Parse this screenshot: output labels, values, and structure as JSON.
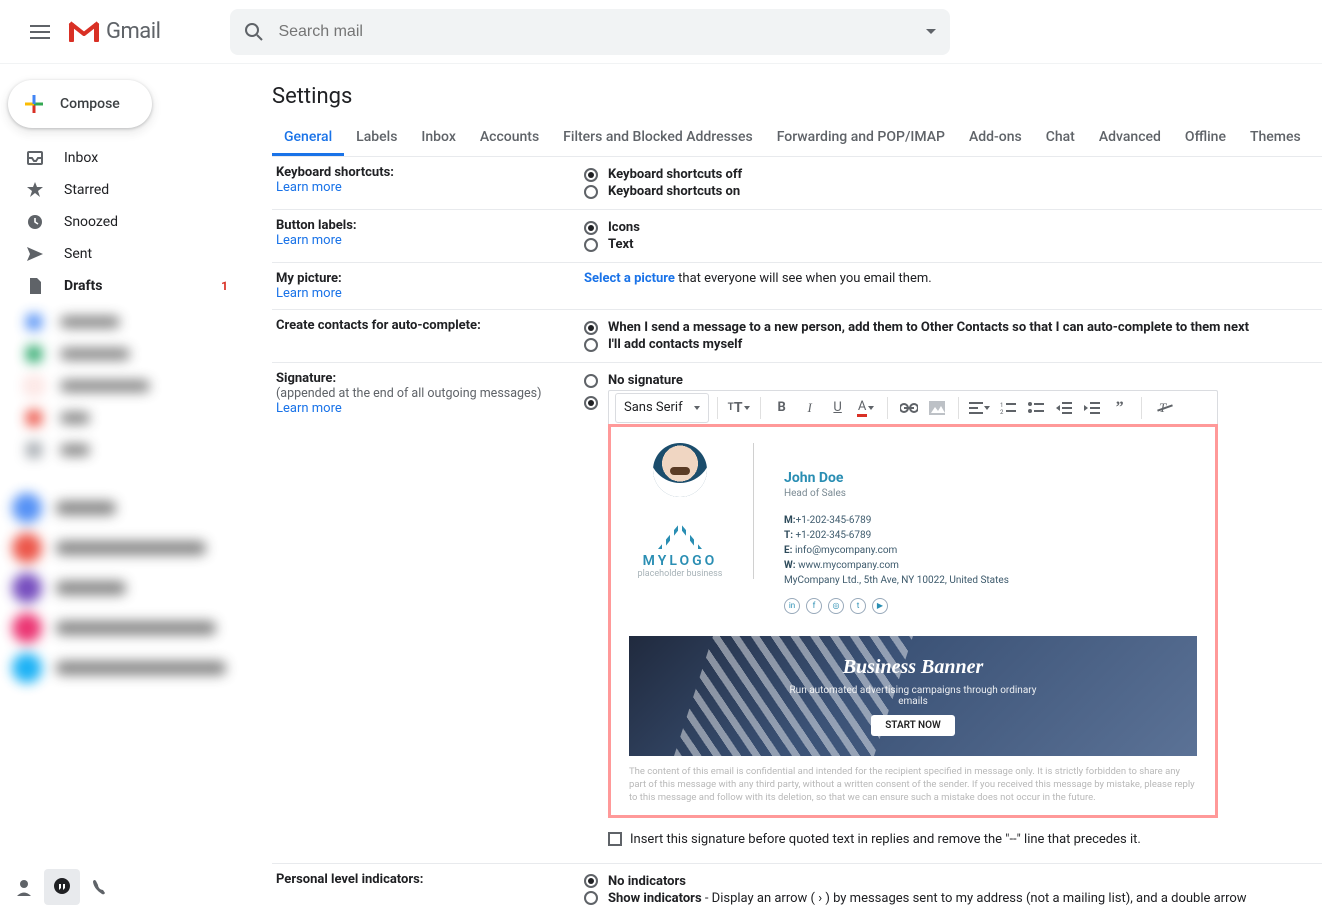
{
  "app": {
    "name": "Gmail"
  },
  "search": {
    "placeholder": "Search mail"
  },
  "compose_label": "Compose",
  "sidebar": {
    "items": [
      {
        "label": "Inbox",
        "active": false,
        "icon": "inbox"
      },
      {
        "label": "Starred",
        "active": false,
        "icon": "star"
      },
      {
        "label": "Snoozed",
        "active": false,
        "icon": "clock"
      },
      {
        "label": "Sent",
        "active": false,
        "icon": "send"
      },
      {
        "label": "Drafts",
        "active": true,
        "icon": "file",
        "count": "1"
      }
    ]
  },
  "page_title": "Settings",
  "tabs": [
    "General",
    "Labels",
    "Inbox",
    "Accounts",
    "Filters and Blocked Addresses",
    "Forwarding and POP/IMAP",
    "Add-ons",
    "Chat",
    "Advanced",
    "Offline",
    "Themes"
  ],
  "active_tab": 0,
  "rows": {
    "keyboard": {
      "label": "Keyboard shortcuts:",
      "learn": "Learn more",
      "options": [
        "Keyboard shortcuts off",
        "Keyboard shortcuts on"
      ],
      "selected": 0
    },
    "buttonlabels": {
      "label": "Button labels:",
      "learn": "Learn more",
      "options": [
        "Icons",
        "Text"
      ],
      "selected": 0
    },
    "picture": {
      "label": "My picture:",
      "learn": "Learn more",
      "link_text": "Select a picture",
      "tail_text": " that everyone will see when you email them."
    },
    "contacts": {
      "label": "Create contacts for auto-complete:",
      "options": [
        "When I send a message to a new person, add them to Other Contacts so that I can auto-complete to them next",
        "I'll add contacts myself"
      ],
      "selected": 0
    },
    "signature": {
      "label": "Signature:",
      "sub": "(appended at the end of all outgoing messages)",
      "learn": "Learn more",
      "no_sig": "No signature",
      "font_name": "Sans Serif",
      "card": {
        "name": "John Doe",
        "title": "Head of Sales",
        "mobile_label": "M:",
        "mobile": "+1-202-345-6789",
        "tel_label": "T:",
        "tel": "+1-202-345-6789",
        "email_label": "E:",
        "email": "info@mycompany.com",
        "web_label": "W:",
        "web": "www.mycompany.com",
        "address": "MyCompany Ltd., 5th Ave, NY 10022, United States",
        "brand_name": "MYLOGO",
        "brand_sub": "placeholder business",
        "social": [
          "in",
          "f",
          "◎",
          "t",
          "▶"
        ]
      },
      "banner": {
        "headline": "Business Banner",
        "sub": "Run automated advertising campaigns through ordinary emails",
        "cta": "START NOW"
      },
      "disclaimer": "The content of this email is confidential and intended for the recipient specified in message only. It is strictly forbidden to share any part of this message with any third party, without a written consent of the sender. If you received this message by mistake, please reply to this message and follow with its deletion, so that we can ensure such a mistake does not occur in the future.",
      "insert_text": "Insert this signature before quoted text in replies and remove the \"--\" line that precedes it."
    },
    "indicators": {
      "label": "Personal level indicators:",
      "options": [
        {
          "bold": "No indicators",
          "rest": ""
        },
        {
          "bold": "Show indicators",
          "rest": " - Display an arrow ( › ) by messages sent to my address (not a mailing list), and a double arrow"
        }
      ],
      "selected": 0
    }
  }
}
